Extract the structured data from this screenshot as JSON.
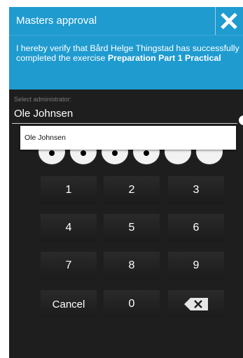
{
  "dialog": {
    "title": "Masters approval",
    "close_icon": "close-icon",
    "message_prefix": "I hereby verify that Bård Helge Thingstad has successfully completed the exercise ",
    "exercise_name": "Preparation Part 1 Practical"
  },
  "administrator": {
    "label": "Select administrator:",
    "selected": "Ole Johnsen",
    "options": [
      "Ole Johnsen"
    ]
  },
  "pin": {
    "length": 6,
    "entered": 4
  },
  "keypad": {
    "keys": [
      "1",
      "2",
      "3",
      "4",
      "5",
      "6",
      "7",
      "8",
      "9"
    ],
    "cancel_label": "Cancel",
    "zero_label": "0",
    "backspace_icon": "backspace-icon"
  },
  "colors": {
    "accent": "#1f9bd0",
    "background": "#1e1e1e"
  }
}
